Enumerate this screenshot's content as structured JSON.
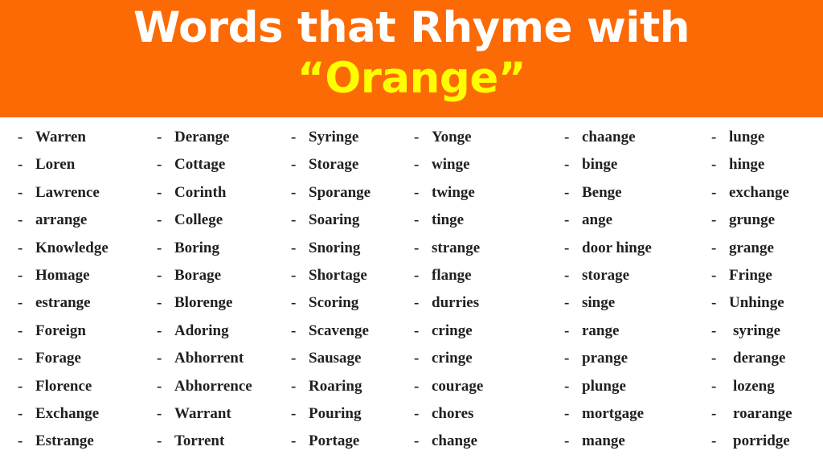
{
  "header": {
    "title_line_1": "Words that Rhyme with",
    "title_line_2": "“Orange”",
    "background_color": "#fc6a05",
    "title_color": "#ffffff",
    "highlight_color": "#ffff00"
  },
  "list": {
    "bullet": "-",
    "text_color": "#231f20",
    "columns": [
      {
        "index": 1,
        "words": [
          "Warren",
          "Loren",
          "Lawrence",
          "arrange",
          "Knowledge",
          "Homage",
          "estrange",
          "Foreign",
          "Forage",
          "Florence",
          "Exchange",
          "Estrange"
        ]
      },
      {
        "index": 2,
        "words": [
          "Derange",
          "Cottage",
          "Corinth",
          "College",
          "Boring",
          "Borage",
          "Blorenge",
          "Adoring",
          "Abhorrent",
          "Abhorrence",
          "Warrant",
          "Torrent"
        ]
      },
      {
        "index": 3,
        "words": [
          "Syringe",
          "Storage",
          "Sporange",
          "Soaring",
          "Snoring",
          "Shortage",
          "Scoring",
          "Scavenge",
          "Sausage",
          "Roaring",
          "Pouring",
          "Portage"
        ]
      },
      {
        "index": 4,
        "words": [
          "Yonge",
          "winge",
          "twinge",
          "tinge",
          "strange",
          "flange",
          "durries",
          "cringe",
          "cringe",
          "courage",
          "chores",
          "change"
        ]
      },
      {
        "index": 5,
        "words": [
          "chaange",
          "binge",
          "Benge",
          "ange",
          "door hinge",
          "storage",
          "singe",
          "range",
          "prange",
          "plunge",
          "mortgage",
          "mange"
        ]
      },
      {
        "index": 6,
        "words": [
          "lunge",
          "hinge",
          "exchange",
          "grunge",
          "grange",
          "Fringe",
          "Unhinge",
          "syringe",
          "derange",
          "lozeng",
          "roarange",
          "porridge"
        ]
      }
    ]
  }
}
